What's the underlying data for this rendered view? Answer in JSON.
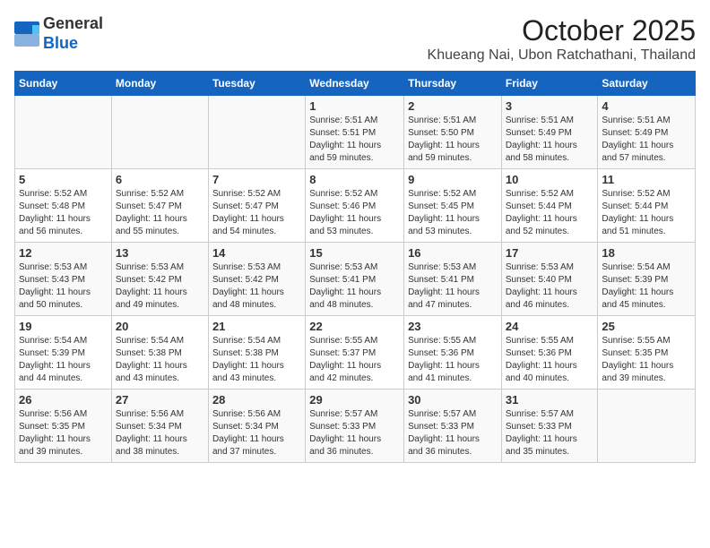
{
  "header": {
    "logo_line1": "General",
    "logo_line2": "Blue",
    "month_title": "October 2025",
    "location": "Khueang Nai, Ubon Ratchathani, Thailand"
  },
  "days_of_week": [
    "Sunday",
    "Monday",
    "Tuesday",
    "Wednesday",
    "Thursday",
    "Friday",
    "Saturday"
  ],
  "weeks": [
    [
      {
        "day": "",
        "text": ""
      },
      {
        "day": "",
        "text": ""
      },
      {
        "day": "",
        "text": ""
      },
      {
        "day": "1",
        "text": "Sunrise: 5:51 AM\nSunset: 5:51 PM\nDaylight: 11 hours\nand 59 minutes."
      },
      {
        "day": "2",
        "text": "Sunrise: 5:51 AM\nSunset: 5:50 PM\nDaylight: 11 hours\nand 59 minutes."
      },
      {
        "day": "3",
        "text": "Sunrise: 5:51 AM\nSunset: 5:49 PM\nDaylight: 11 hours\nand 58 minutes."
      },
      {
        "day": "4",
        "text": "Sunrise: 5:51 AM\nSunset: 5:49 PM\nDaylight: 11 hours\nand 57 minutes."
      }
    ],
    [
      {
        "day": "5",
        "text": "Sunrise: 5:52 AM\nSunset: 5:48 PM\nDaylight: 11 hours\nand 56 minutes."
      },
      {
        "day": "6",
        "text": "Sunrise: 5:52 AM\nSunset: 5:47 PM\nDaylight: 11 hours\nand 55 minutes."
      },
      {
        "day": "7",
        "text": "Sunrise: 5:52 AM\nSunset: 5:47 PM\nDaylight: 11 hours\nand 54 minutes."
      },
      {
        "day": "8",
        "text": "Sunrise: 5:52 AM\nSunset: 5:46 PM\nDaylight: 11 hours\nand 53 minutes."
      },
      {
        "day": "9",
        "text": "Sunrise: 5:52 AM\nSunset: 5:45 PM\nDaylight: 11 hours\nand 53 minutes."
      },
      {
        "day": "10",
        "text": "Sunrise: 5:52 AM\nSunset: 5:44 PM\nDaylight: 11 hours\nand 52 minutes."
      },
      {
        "day": "11",
        "text": "Sunrise: 5:52 AM\nSunset: 5:44 PM\nDaylight: 11 hours\nand 51 minutes."
      }
    ],
    [
      {
        "day": "12",
        "text": "Sunrise: 5:53 AM\nSunset: 5:43 PM\nDaylight: 11 hours\nand 50 minutes."
      },
      {
        "day": "13",
        "text": "Sunrise: 5:53 AM\nSunset: 5:42 PM\nDaylight: 11 hours\nand 49 minutes."
      },
      {
        "day": "14",
        "text": "Sunrise: 5:53 AM\nSunset: 5:42 PM\nDaylight: 11 hours\nand 48 minutes."
      },
      {
        "day": "15",
        "text": "Sunrise: 5:53 AM\nSunset: 5:41 PM\nDaylight: 11 hours\nand 48 minutes."
      },
      {
        "day": "16",
        "text": "Sunrise: 5:53 AM\nSunset: 5:41 PM\nDaylight: 11 hours\nand 47 minutes."
      },
      {
        "day": "17",
        "text": "Sunrise: 5:53 AM\nSunset: 5:40 PM\nDaylight: 11 hours\nand 46 minutes."
      },
      {
        "day": "18",
        "text": "Sunrise: 5:54 AM\nSunset: 5:39 PM\nDaylight: 11 hours\nand 45 minutes."
      }
    ],
    [
      {
        "day": "19",
        "text": "Sunrise: 5:54 AM\nSunset: 5:39 PM\nDaylight: 11 hours\nand 44 minutes."
      },
      {
        "day": "20",
        "text": "Sunrise: 5:54 AM\nSunset: 5:38 PM\nDaylight: 11 hours\nand 43 minutes."
      },
      {
        "day": "21",
        "text": "Sunrise: 5:54 AM\nSunset: 5:38 PM\nDaylight: 11 hours\nand 43 minutes."
      },
      {
        "day": "22",
        "text": "Sunrise: 5:55 AM\nSunset: 5:37 PM\nDaylight: 11 hours\nand 42 minutes."
      },
      {
        "day": "23",
        "text": "Sunrise: 5:55 AM\nSunset: 5:36 PM\nDaylight: 11 hours\nand 41 minutes."
      },
      {
        "day": "24",
        "text": "Sunrise: 5:55 AM\nSunset: 5:36 PM\nDaylight: 11 hours\nand 40 minutes."
      },
      {
        "day": "25",
        "text": "Sunrise: 5:55 AM\nSunset: 5:35 PM\nDaylight: 11 hours\nand 39 minutes."
      }
    ],
    [
      {
        "day": "26",
        "text": "Sunrise: 5:56 AM\nSunset: 5:35 PM\nDaylight: 11 hours\nand 39 minutes."
      },
      {
        "day": "27",
        "text": "Sunrise: 5:56 AM\nSunset: 5:34 PM\nDaylight: 11 hours\nand 38 minutes."
      },
      {
        "day": "28",
        "text": "Sunrise: 5:56 AM\nSunset: 5:34 PM\nDaylight: 11 hours\nand 37 minutes."
      },
      {
        "day": "29",
        "text": "Sunrise: 5:57 AM\nSunset: 5:33 PM\nDaylight: 11 hours\nand 36 minutes."
      },
      {
        "day": "30",
        "text": "Sunrise: 5:57 AM\nSunset: 5:33 PM\nDaylight: 11 hours\nand 36 minutes."
      },
      {
        "day": "31",
        "text": "Sunrise: 5:57 AM\nSunset: 5:33 PM\nDaylight: 11 hours\nand 35 minutes."
      },
      {
        "day": "",
        "text": ""
      }
    ]
  ]
}
